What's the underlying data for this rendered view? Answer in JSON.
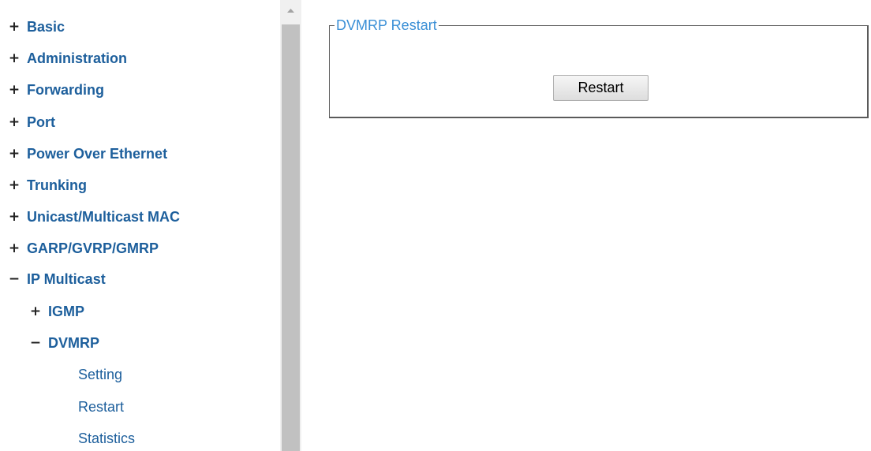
{
  "sidebar": {
    "items": [
      {
        "toggle": "+",
        "label": "Basic"
      },
      {
        "toggle": "+",
        "label": "Administration"
      },
      {
        "toggle": "+",
        "label": "Forwarding"
      },
      {
        "toggle": "+",
        "label": "Port"
      },
      {
        "toggle": "+",
        "label": "Power Over Ethernet"
      },
      {
        "toggle": "+",
        "label": "Trunking"
      },
      {
        "toggle": "+",
        "label": "Unicast/Multicast MAC"
      },
      {
        "toggle": "+",
        "label": "GARP/GVRP/GMRP"
      },
      {
        "toggle": "−",
        "label": "IP Multicast"
      },
      {
        "toggle": "+",
        "label": "IGMP"
      },
      {
        "toggle": "−",
        "label": "DVMRP"
      }
    ],
    "children": [
      {
        "label": "Setting"
      },
      {
        "label": "Restart"
      },
      {
        "label": "Statistics"
      }
    ]
  },
  "main": {
    "legend": "DVMRP Restart",
    "restart_button": "Restart"
  },
  "icons": {
    "scroll_up": "scroll-up-arrow-icon"
  },
  "colors": {
    "nav_link": "#1d5f9c",
    "legend": "#3a8fd6",
    "scroll_thumb": "#c1c1c1"
  }
}
